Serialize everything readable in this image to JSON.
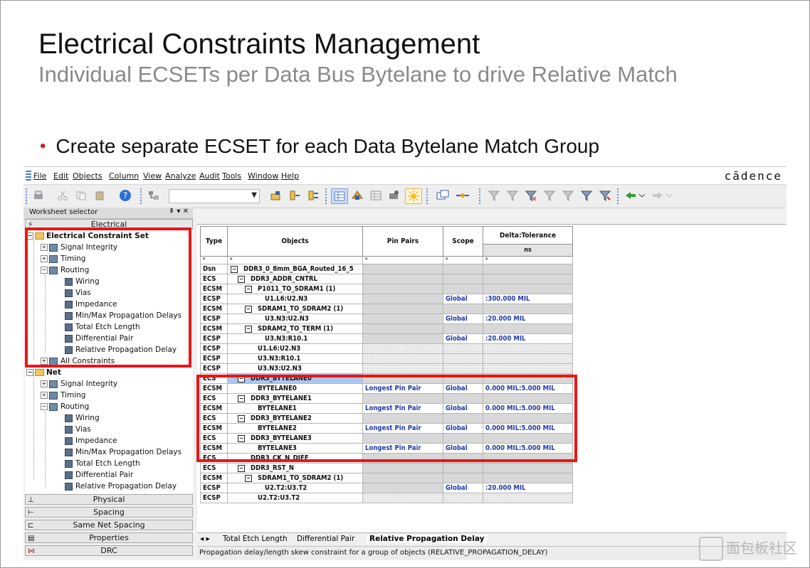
{
  "slide": {
    "title": "Electrical Constraints Management",
    "subtitle": "Individual ECSETs per Data Bus Bytelane to drive Relative Match",
    "bullet": "Create separate ECSET for each Data Bytelane Match Group"
  },
  "app": {
    "brand": "cādence",
    "menu": [
      "File",
      "Edit",
      "Objects",
      "Column",
      "View",
      "Analyze",
      "Audit",
      "Tools",
      "Window",
      "Help"
    ],
    "toolbar_icons": [
      "print-icon",
      "cut-icon",
      "copy-icon",
      "paste-icon",
      "help-icon",
      "filter-icon",
      "set-icon",
      "pin-icon",
      "pin2-icon",
      "grid-icon",
      "analyze-icon",
      "grid2-icon",
      "tools-icon",
      "sun-icon",
      "window-icon",
      "link-icon",
      "filter1-icon",
      "filter2-icon",
      "filter3-icon",
      "filter4-icon",
      "filter5-icon",
      "filter6-icon",
      "filter7-icon",
      "back-icon",
      "forward-icon"
    ],
    "worksheet_selector": {
      "title": "Worksheet selector",
      "controls": "⇞ ▾ ✕"
    },
    "categories_top": [
      "Electrical"
    ],
    "categories_bottom": [
      "Physical",
      "Spacing",
      "Same Net Spacing",
      "Properties",
      "DRC"
    ],
    "tree": {
      "set_label": "Electrical Constraint Set",
      "set_items": [
        "Signal Integrity",
        "Timing",
        "Routing"
      ],
      "routing_items": [
        "Wiring",
        "Vias",
        "Impedance",
        "Min/Max Propagation Delays",
        "Total Etch Length",
        "Differential Pair",
        "Relative Propagation Delay"
      ],
      "all_constraints": "All Constraints",
      "net_label": "Net",
      "net_items": [
        "Signal Integrity",
        "Timing",
        "Routing"
      ],
      "net_routing_items": [
        "Wiring",
        "Vias",
        "Impedance",
        "Min/Max Propagation Delays",
        "Total Etch Length",
        "Differential Pair",
        "Relative Propagation Delay"
      ]
    },
    "grid": {
      "headers": {
        "type": "Type",
        "objects": "Objects",
        "pin_pairs": "Pin Pairs",
        "scope": "Scope",
        "delta": "Delta:Tolerance",
        "unit": "ns"
      },
      "filter_row": [
        "*",
        "*",
        "*",
        "*",
        "*"
      ],
      "rows": [
        {
          "type": "Dsn",
          "obj": "DDR3_0_8mm_BGA_Routed_16_5",
          "ind": 0,
          "minus": true,
          "pp": "",
          "scope": "",
          "delta": "",
          "cls": "gray"
        },
        {
          "type": "ECS",
          "obj": "DDR3_ADDR_CNTRL",
          "ind": 1,
          "minus": true,
          "pp": "",
          "scope": "",
          "delta": "",
          "cls": "gray"
        },
        {
          "type": "ECSM",
          "obj": "P1011_TO_SDRAM1 (1)",
          "ind": 2,
          "minus": true,
          "pp": "",
          "scope": "",
          "delta": "",
          "cls": "gray"
        },
        {
          "type": "ECSP",
          "obj": "U1.L6:U2.N3",
          "ind": 3,
          "minus": false,
          "pp": "",
          "scope": "Global",
          "delta": ":300.000 MIL",
          "cls": "val"
        },
        {
          "type": "ECSM",
          "obj": "SDRAM1_TO_SDRAM2 (1)",
          "ind": 2,
          "minus": true,
          "pp": "",
          "scope": "",
          "delta": "",
          "cls": "gray"
        },
        {
          "type": "ECSP",
          "obj": "U3.N3:U2.N3",
          "ind": 3,
          "minus": false,
          "pp": "",
          "scope": "Global",
          "delta": ":20.000 MIL",
          "cls": "val"
        },
        {
          "type": "ECSM",
          "obj": "SDRAM2_TO_TERM (1)",
          "ind": 2,
          "minus": true,
          "pp": "",
          "scope": "",
          "delta": "",
          "cls": "gray"
        },
        {
          "type": "ECSP",
          "obj": "U3.N3:R10.1",
          "ind": 3,
          "minus": false,
          "pp": "",
          "scope": "Global",
          "delta": ":20.000 MIL",
          "cls": "val"
        },
        {
          "type": "ECSP",
          "obj": "U1.L6:U2.N3",
          "ind": 2,
          "minus": false,
          "pp": "",
          "scope": "",
          "delta": "",
          "cls": "dot"
        },
        {
          "type": "ECSP",
          "obj": "U3.N3:R10.1",
          "ind": 2,
          "minus": false,
          "pp": "",
          "scope": "",
          "delta": "",
          "cls": "dot"
        },
        {
          "type": "ECSP",
          "obj": "U3.N3:U2.N3",
          "ind": 2,
          "minus": false,
          "pp": "",
          "scope": "",
          "delta": "",
          "cls": "dot"
        },
        {
          "type": "ECS",
          "obj": "DDR3_BYTELANE0",
          "ind": 1,
          "minus": true,
          "pp": "",
          "scope": "",
          "delta": "",
          "cls": "sel"
        },
        {
          "type": "ECSM",
          "obj": "BYTELANE0",
          "ind": 2,
          "minus": false,
          "pp": "Longest Pin Pair",
          "scope": "Global",
          "delta": "0.000 MIL:5.000 MIL",
          "cls": "val"
        },
        {
          "type": "ECS",
          "obj": "DDR3_BYTELANE1",
          "ind": 1,
          "minus": true,
          "pp": "",
          "scope": "",
          "delta": "",
          "cls": "gray"
        },
        {
          "type": "ECSM",
          "obj": "BYTELANE1",
          "ind": 2,
          "minus": false,
          "pp": "Longest Pin Pair",
          "scope": "Global",
          "delta": "0.000 MIL:5.000 MIL",
          "cls": "val"
        },
        {
          "type": "ECS",
          "obj": "DDR3_BYTELANE2",
          "ind": 1,
          "minus": true,
          "pp": "",
          "scope": "",
          "delta": "",
          "cls": "gray"
        },
        {
          "type": "ECSM",
          "obj": "BYTELANE2",
          "ind": 2,
          "minus": false,
          "pp": "Longest Pin Pair",
          "scope": "Global",
          "delta": "0.000 MIL:5.000 MIL",
          "cls": "val"
        },
        {
          "type": "ECS",
          "obj": "DDR3_BYTELANE3",
          "ind": 1,
          "minus": true,
          "pp": "",
          "scope": "",
          "delta": "",
          "cls": "gray"
        },
        {
          "type": "ECSM",
          "obj": "BYTELANE3",
          "ind": 2,
          "minus": false,
          "pp": "Longest Pin Pair",
          "scope": "Global",
          "delta": "0.000 MIL:5.000 MIL",
          "cls": "val"
        },
        {
          "type": "ECS",
          "obj": "DDR3_CK_N_DIFF",
          "ind": 1,
          "minus": false,
          "pp": "",
          "scope": "",
          "delta": "",
          "cls": "gray"
        },
        {
          "type": "ECS",
          "obj": "DDR3_RST_N",
          "ind": 1,
          "minus": true,
          "pp": "",
          "scope": "",
          "delta": "",
          "cls": "gray"
        },
        {
          "type": "ECSM",
          "obj": "SDRAM1_TO_SDRAM2 (1)",
          "ind": 2,
          "minus": true,
          "pp": "",
          "scope": "",
          "delta": "",
          "cls": "gray"
        },
        {
          "type": "ECSP",
          "obj": "U2.T2:U3.T2",
          "ind": 3,
          "minus": false,
          "pp": "",
          "scope": "Global",
          "delta": ":20.000 MIL",
          "cls": "val"
        },
        {
          "type": "ECSP",
          "obj": "U2.T2:U3.T2",
          "ind": 2,
          "minus": false,
          "pp": "",
          "scope": "",
          "delta": "",
          "cls": "dot"
        }
      ]
    },
    "tabs": {
      "nav": "◂ ▸",
      "items": [
        "Total Etch Length",
        "Differential Pair",
        "Relative Propagation Delay"
      ]
    },
    "status": "Propagation delay/length skew constraint for a group of objects (RELATIVE_PROPAGATION_DELAY)",
    "highlight_color": "#ee1414",
    "accent_blue": "#1f3aa6"
  },
  "watermark": "面包板社区"
}
